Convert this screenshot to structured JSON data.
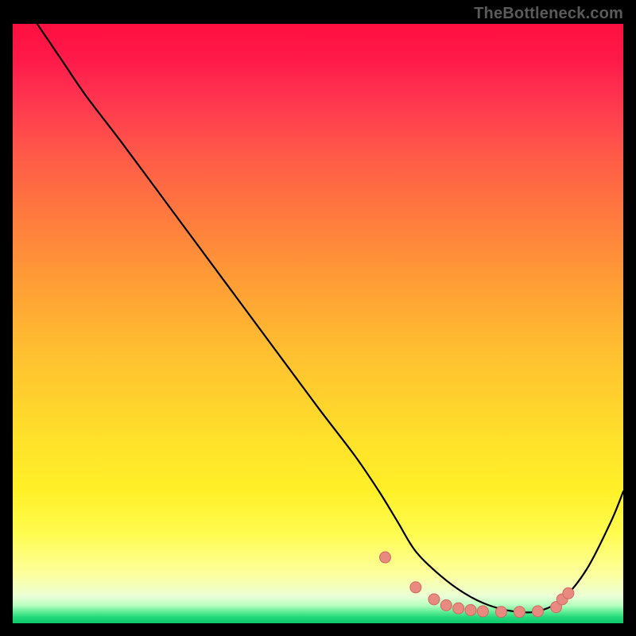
{
  "watermark": "TheBottleneck.com",
  "chart_data": {
    "type": "line",
    "title": "",
    "xlabel": "",
    "ylabel": "",
    "xlim": [
      0,
      100
    ],
    "ylim": [
      0,
      100
    ],
    "grid": false,
    "series": [
      {
        "name": "bottleneck-curve",
        "x": [
          4,
          8,
          12,
          18,
          26,
          34,
          42,
          50,
          56,
          60,
          63,
          66,
          70,
          74,
          78,
          82,
          86,
          90,
          94,
          98,
          100
        ],
        "y": [
          100,
          94,
          88,
          80,
          69,
          58,
          47,
          36,
          28,
          22,
          17,
          12,
          8,
          5,
          3,
          2,
          2,
          4,
          9,
          17,
          22
        ]
      }
    ],
    "markers": {
      "name": "bottleneck-dots",
      "x": [
        61,
        66,
        69,
        71,
        73,
        75,
        77,
        80,
        83,
        86,
        89,
        90,
        91
      ],
      "y": [
        11,
        6,
        4,
        3,
        2.5,
        2.2,
        2.0,
        1.9,
        1.9,
        2.0,
        2.7,
        4,
        5
      ]
    },
    "colors": {
      "line": "#000000",
      "marker_fill": "#e88a80",
      "marker_stroke": "#d06a60"
    }
  }
}
